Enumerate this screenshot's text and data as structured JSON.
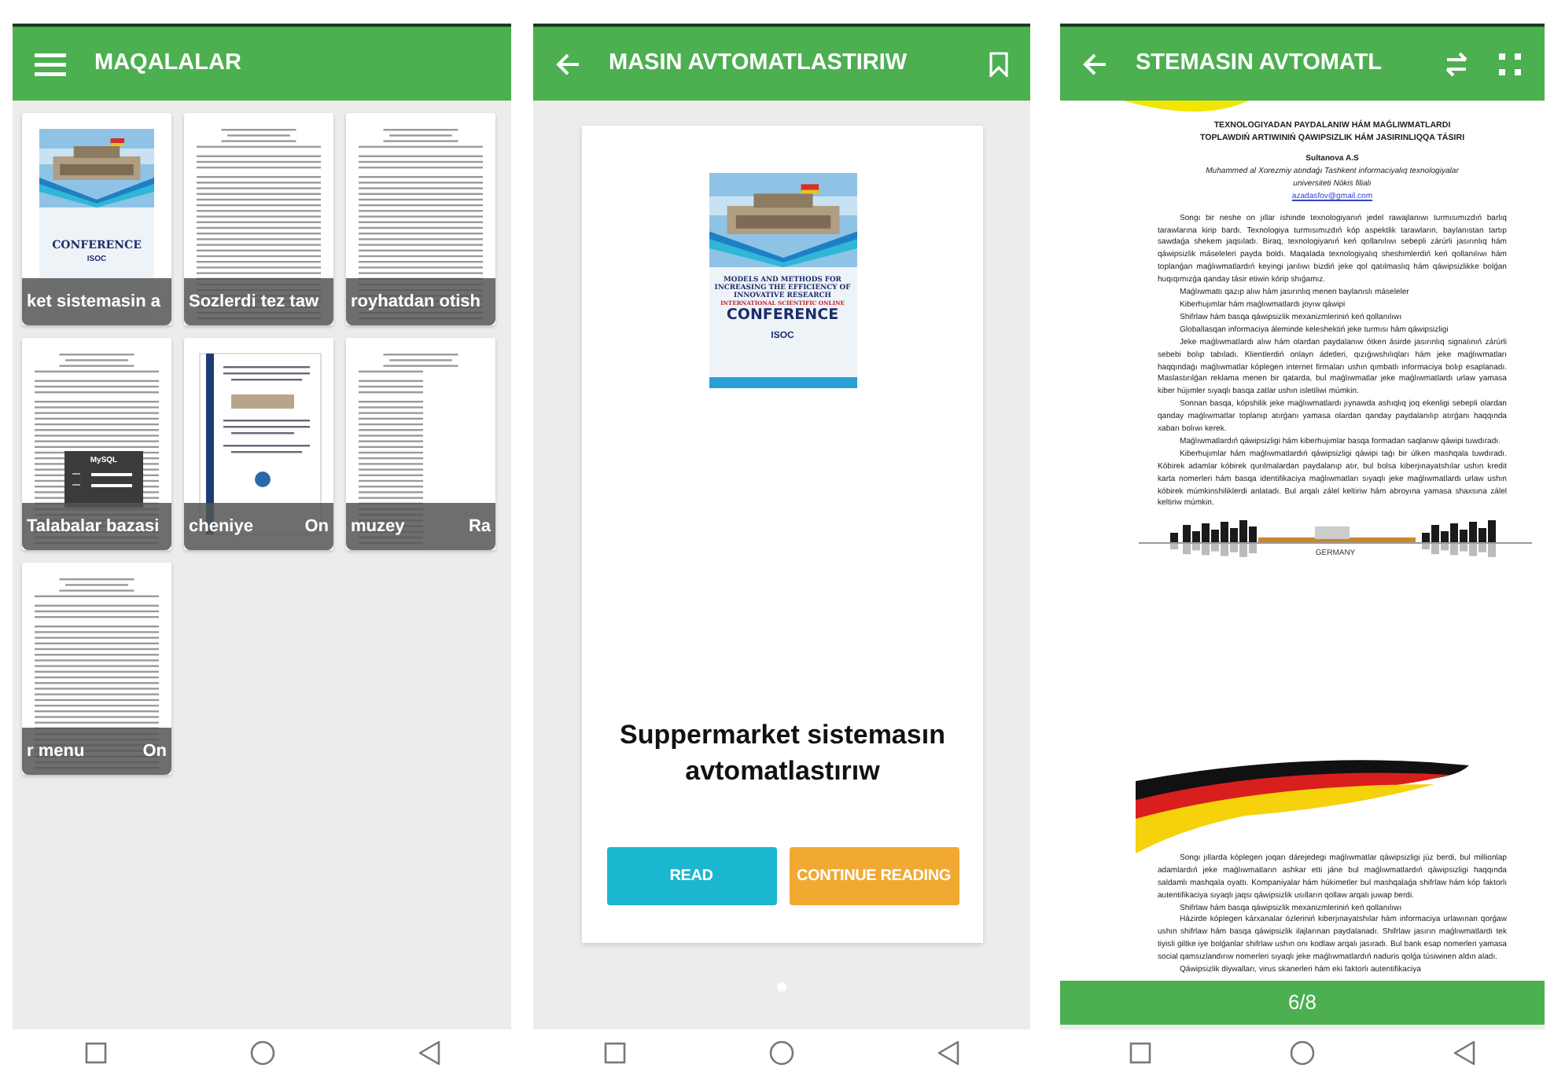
{
  "library_screen": {
    "title": "MAQALALAR",
    "articles": [
      {
        "kind": "cover",
        "cover_texts": [
          "CONFERENCE",
          "ISOC"
        ],
        "labels": [
          "ket sistemasin a"
        ]
      },
      {
        "kind": "page",
        "labels": [
          "Sozlerdi tez taw"
        ]
      },
      {
        "kind": "page",
        "labels": [
          "royhatdan otish"
        ]
      },
      {
        "kind": "login",
        "overlay_title": "MySQL",
        "labels": [
          "Talabalar bazasi"
        ]
      },
      {
        "kind": "framed",
        "labels": [
          "cheniye",
          "On"
        ]
      },
      {
        "kind": "page",
        "labels": [
          "muzey",
          "Ra"
        ]
      },
      {
        "kind": "page",
        "labels": [
          "r menu",
          "On"
        ]
      }
    ]
  },
  "detail_screen": {
    "title": "MASIN AVTOMATLASTIRIW",
    "poster": {
      "lines": [
        "MODELS AND METHODS FOR",
        "INCREASING THE EFFICIENCY OF",
        "INNOVATIVE RESEARCH"
      ],
      "subline": "INTERNATIONAL SCIENTIFIC ONLINE",
      "headline": "CONFERENCE",
      "logo": "ISOC"
    },
    "book_title": "Suppermarket sistemasın avtomatlastırıw",
    "buttons": [
      {
        "kind": "read",
        "label": "READ"
      },
      {
        "kind": "continue",
        "label": "CONTINUE READING"
      }
    ],
    "pager": [
      {
        "selected": true
      }
    ]
  },
  "reader_screen": {
    "title": "STEMASIN AVTOMATL",
    "page_top": {
      "heading": [
        "TEXNOLOGIYADAN PAYDALANIW HÁM MAǴLIWMATLARDI",
        "TOPLAWDIŃ ARTIWINIŃ QAWIPSIZLIK HÁM JASIRINLIQQA TÁSIRI"
      ],
      "author": "Sultanova A.S",
      "affiliation": "Muhammed al Xorezmiy atındaǵı Tashkent informaciyalıq texnologiyalar universiteti Nókis filialı",
      "email": "azadasfov@gmail.com",
      "paragraphs": [
        {
          "kind": "para",
          "text": "Songı bir neshe on jıllar ishinde texnologiyanıń jedel rawajlanıwı turmısımızdıń barlıq tarawlarına kirip bardı. Texnologiya turmısımızdıń kóp aspektlik tarawların, baylanıstan tartıp sawdaǵa shekem jaqsıladı. Biraq, texnologiyanıń keń qollanılıwı sebepli zárúrli jasırınlıq hám qáwipsizlik máseleleri payda boldı. Maqalada texnologiyalıq sheshimlerdiń keń qollanılıwı hám toplanǵan maǵlıwmatlardıń keyingi jarılıwı bizdiń jeke qol qatılmaslıq hám qáwipsizlikke bolǵan huqıqımızǵa qanday tásir etiwin kórip shıǵamız."
        },
        {
          "kind": "item",
          "text": "Maǵlıwmattı qazıp alıw hám jasırınlıq menen baylanıslı máseleler"
        },
        {
          "kind": "item",
          "text": "Kiberhujımlar hám maǵlıwmatlardı joyıw qáwipi"
        },
        {
          "kind": "item",
          "text": "Shifrlaw hám basqa qáwipsizlik mexanizmleriniń keń qollanılıwı"
        },
        {
          "kind": "item",
          "text": "Globallasqan informaciya áleminde keleshektiń jeke turmısı hám qáwipsizligi"
        },
        {
          "kind": "para",
          "text": "Jeke maǵlıwmatlardı alıw hám olardan paydalanıw ótken ásirde jasırınlıq signalınıń zárúrli sebebi bolıp tabıladı. Klientlerdiń onlayn ádetleri, qızıǵıwshılıqları hám jeke maǵlıwmatları haqqındaǵı maǵlıwmatlar kóplegen internet firmaları ushın qımbatlı informaciya bolıp esaplanadı. Maslastırılǵan reklama menen bir qatarda, bul maǵlıwmatlar jeke maǵlıwmatlardı urlaw yamasa kiber hújımler sıyaqlı basqa zatlar ushın isletiliwi múmkin."
        },
        {
          "kind": "para",
          "text": "Sonnan basqa, kópshilik jeke maǵlıwmatlardı jıynawda ashıqlıq joq ekenligi sebepli olardan qanday maǵlıwmatlar toplanıp atırǵanı yamasa olardan qanday paydalanılıp atırǵanı haqqında xabarı bolıwı kerek."
        },
        {
          "kind": "para",
          "text": "Maǵlıwmatlardıń qáwipsizligi hám kiberhujımlar basqa formadan saqlanıw qáwipi tuwdıradı."
        },
        {
          "kind": "para",
          "text": "Kiberhujımlar hám maǵlıwmatlardıń qáwipsizligi qáwipi taǵı bir úlken mashqala tuwdıradı. Kóbirek adamlar kóbirek qurılmalardan paydalanıp atır, bul bolsa kiberjınayatshılar ushın kredit karta nomerleri hám basqa identifikaciya maǵlıwmatları sıyaqlı jeke maǵlıwmatlardı urlaw ushın kóbirek múmkinshiliklerdi anlatadı. Bul arqalı zálel keltiriw hám abroyına yamasa shaxsına zálel keltiriw múmkin."
        }
      ],
      "skyline_caption": "GERMANY"
    },
    "page_bottom": {
      "paragraphs": [
        {
          "kind": "para",
          "text": "Songı jıllarda kóplegen joqarı dárejedegi maǵlıwmatlar qáwipsizligi júz berdi, bul millionlap adamlardıń jeke maǵlıwmatların ashkar etti jáne bul maǵlıwmatlardıń qáwipsizligi haqqında saldamlı mashqala oyattı. Kompaniyalar hám húkimetler bul mashqalaǵa shifrlaw hám kóp faktorlı autentifikaciya sıyaqlı jaqsı qáwipsizlik usılların qollaw arqalı juwap berdi."
        },
        {
          "kind": "item",
          "text": "Shifrlaw hám basqa qáwipsizlik mexanizmleriniń keń qollanılıwı"
        },
        {
          "kind": "para",
          "text": "Házirde kóplegen kárxanalar ózleriniń kiberjınayatshılar hám informaciya urlawınan qorǵaw ushın shifrlaw hám basqa qáwipsizlik ilajlarınan paydalanadı. Shifrlaw jasırın maǵlıwmatlardı tek tiyisli giltke iye bolǵanlar shifrlaw ushın onı kodlaw arqalı jasıradı. Bul bank esap nomerleri yamasa social qamsızlandırıw nomerleri sıyaqlı jeke maǵlıwmatlardıń naduris qolǵa túsiwinen aldın aladı."
        },
        {
          "kind": "para",
          "text": "Qáwipsizlik diywalları, virus skanerleri hám eki faktorlı autentifikaciya"
        }
      ]
    },
    "page_indicator": "6/8"
  }
}
